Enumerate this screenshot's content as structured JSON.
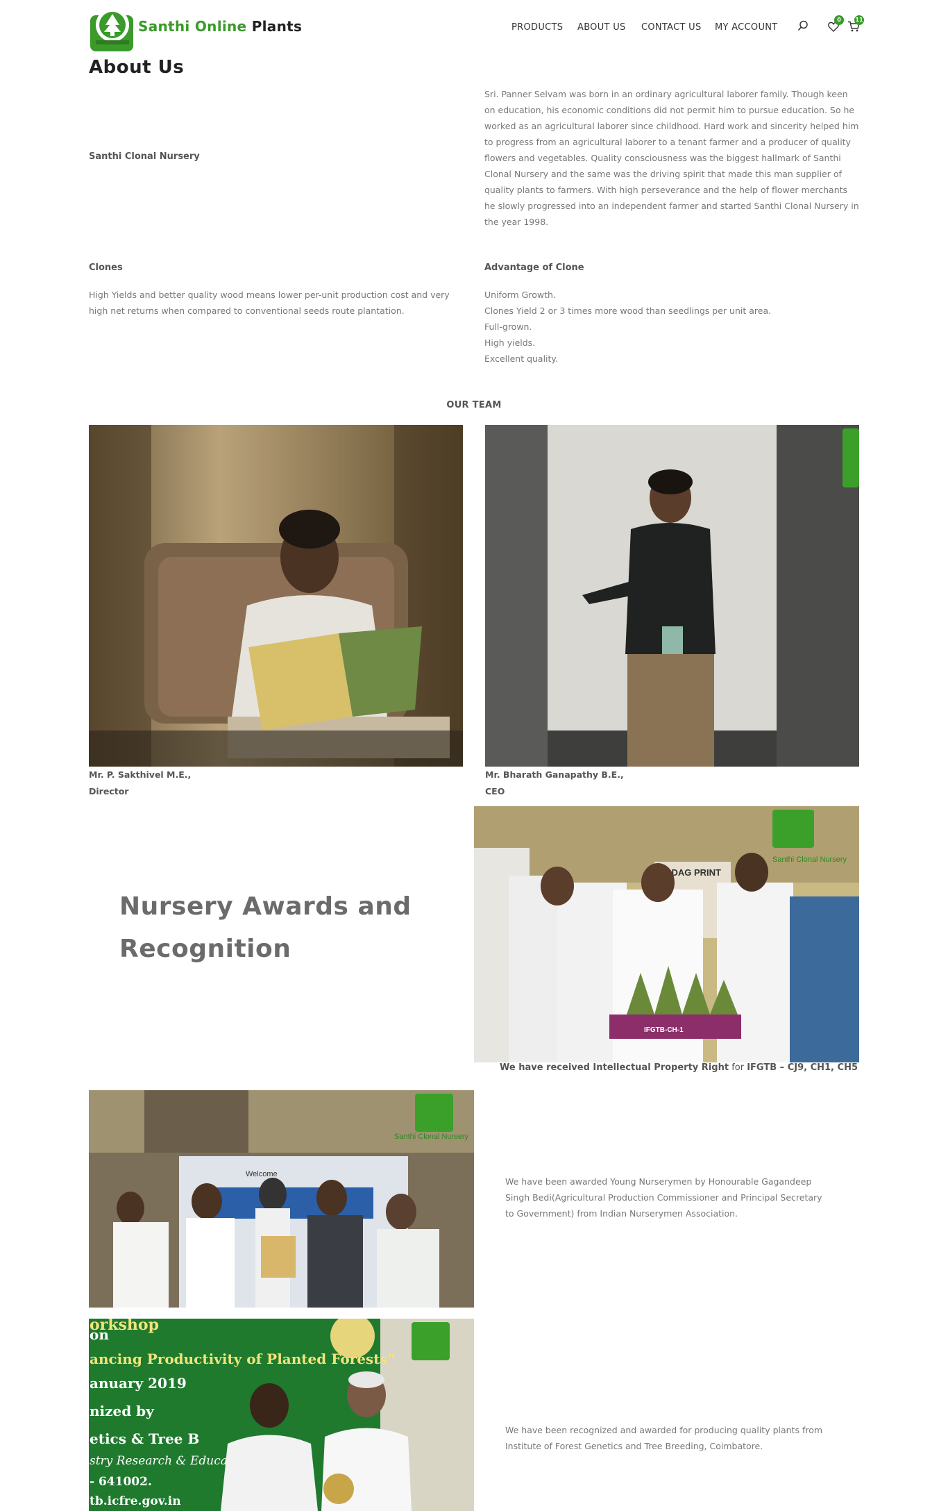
{
  "header": {
    "brand_part1": "Santhi Online",
    "brand_part2": "Plants",
    "nav": [
      "PRODUCTS",
      "ABOUT US",
      "CONTACT US",
      "MY ACCOUNT"
    ],
    "wishlist_count": "0",
    "cart_count": "11",
    "icons": [
      "search-icon",
      "heart-icon",
      "cart-icon"
    ],
    "accent_color": "#3a9a2a"
  },
  "page_title": "About Us",
  "intro": {
    "label": "Santhi Clonal Nursery",
    "text": "Sri. Panner Selvam was born in an ordinary agricultural laborer family. Though keen on education, his economic conditions did not permit him to pursue education. So he worked as an agricultural laborer since childhood. Hard work and sincerity helped him to progress from an agricultural laborer to a tenant farmer and a producer of quality flowers and vegetables. Quality consciousness was the biggest hallmark of Santhi Clonal Nursery and the same was the driving spirit that made this man supplier of quality plants to farmers. With high perseverance and the help of flower merchants he slowly progressed into an independent farmer and started Santhi Clonal Nursery in the year 1998."
  },
  "clones": {
    "label": "Clones",
    "text": "High Yields and better quality wood means lower per-unit production cost and very high net returns when compared to conventional seeds route plantation."
  },
  "advantage": {
    "label": "Advantage of Clone",
    "items": [
      "Uniform Growth.",
      "Clones Yield 2 or 3 times more wood than seedlings per unit area.",
      "Full-grown.",
      "High yields.",
      "Excellent quality."
    ]
  },
  "team": {
    "heading": "OUR TEAM",
    "members": [
      {
        "name": "Mr. P. Sakthivel M.E.,",
        "role": "Director"
      },
      {
        "name": "Mr. Bharath Ganapathy B.E.,",
        "role": "CEO"
      }
    ]
  },
  "awards": {
    "title": "Nursery Awards and Recognition",
    "photo_watermark": "Santhi Clonal Nursery",
    "calendar_text": "ORDAG PRINT",
    "tray_label": "IFGTB-CH-1",
    "ip_caption_bold": "We have received Intellectual Property Right",
    "ip_caption_for": "for",
    "ip_caption_bold2": "IFGTB – CJ9, CH1, CH5",
    "young_nurserymen": "We have been awarded Young Nurserymen by Honourable Gagandeep Singh Bedi(Agricultural Production Commissioner and Principal Secretary to Government) from Indian Nurserymen Association.",
    "banner_text": "Welcome",
    "workshop_banner": [
      "orkshop",
      "on",
      "ancing Productivity of Planted Forests\"",
      "anuary 2019",
      "nized by",
      "etics & Tree B",
      "stry Research & Educa",
      "- 641002.",
      "tb.icfre.gov.in"
    ],
    "quality_plants": "We have been recognized and awarded for producing quality plants from Institute of Forest Genetics and Tree Breeding, Coimbatore."
  }
}
